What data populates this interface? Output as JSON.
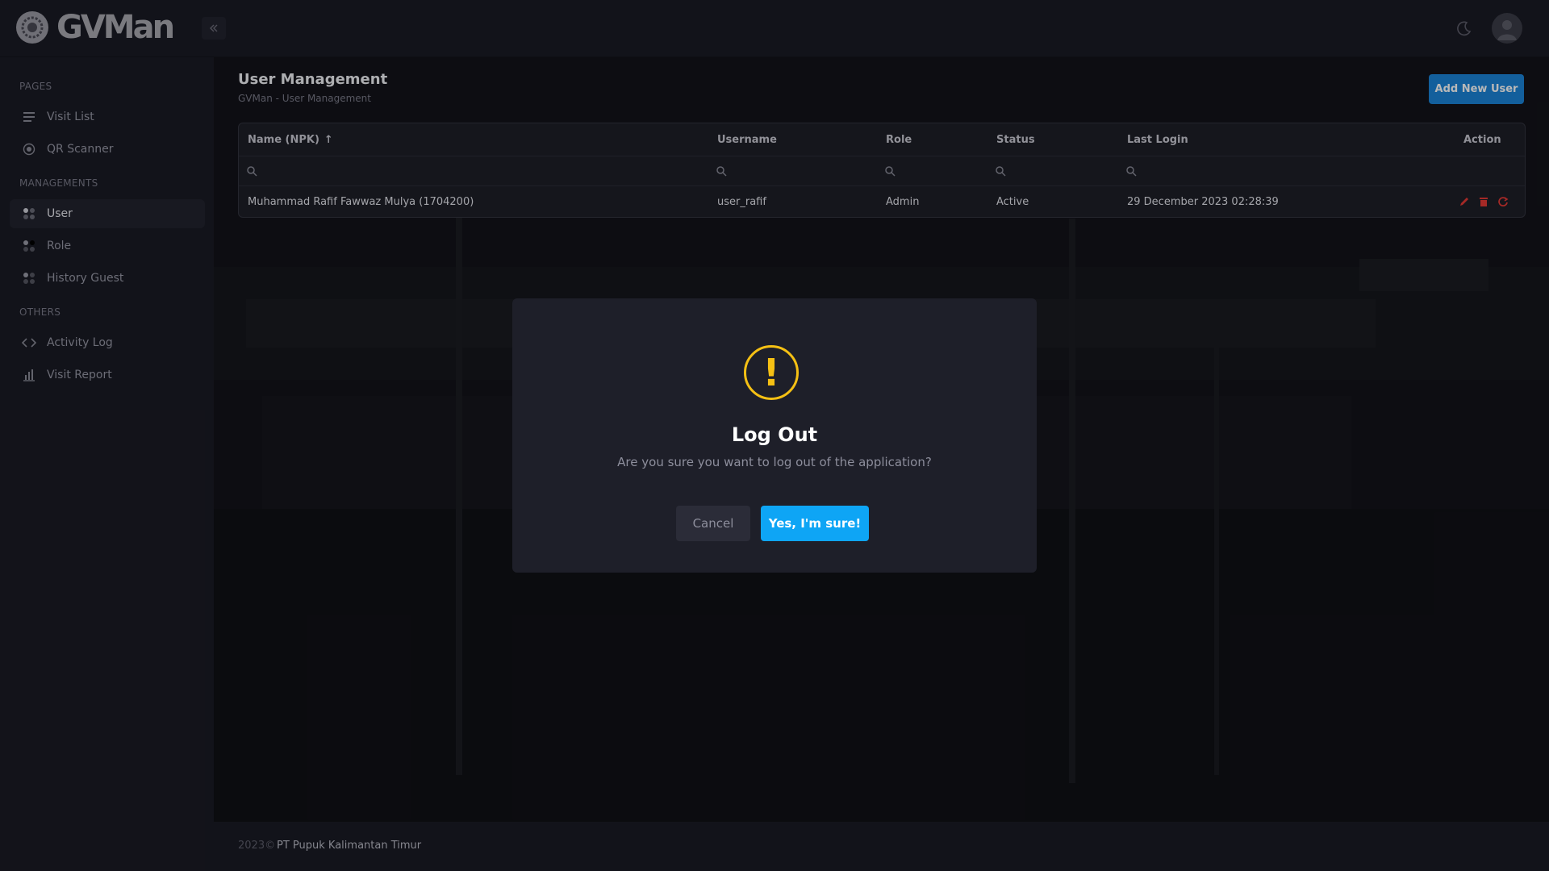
{
  "app": {
    "brand": "GVMan"
  },
  "sidebar": {
    "sections": [
      {
        "title": "PAGES",
        "items": [
          {
            "label": "Visit List",
            "icon": "list-icon"
          },
          {
            "label": "QR Scanner",
            "icon": "target-icon"
          }
        ]
      },
      {
        "title": "MANAGEMENTS",
        "items": [
          {
            "label": "User",
            "icon": "grid-dots-icon",
            "active": true
          },
          {
            "label": "Role",
            "icon": "grid-dots-icon"
          },
          {
            "label": "History Guest",
            "icon": "grid-dots-icon"
          }
        ]
      },
      {
        "title": "OTHERS",
        "items": [
          {
            "label": "Activity Log",
            "icon": "code-icon"
          },
          {
            "label": "Visit Report",
            "icon": "bar-chart-icon"
          }
        ]
      }
    ]
  },
  "page": {
    "title": "User Management",
    "breadcrumb": "GVMan - User Management",
    "add_button": "Add New User"
  },
  "table": {
    "columns": [
      "Name (NPK)",
      "Username",
      "Role",
      "Status",
      "Last Login",
      "Action"
    ],
    "sort_indicator": "↑",
    "rows": [
      {
        "name": "Muhammad Rafif Fawwaz Mulya (1704200)",
        "username": "user_rafif",
        "role": "Admin",
        "status": "Active",
        "last_login": "29 December 2023 02:28:39"
      }
    ]
  },
  "footer": {
    "year": "2023©",
    "company": "PT Pupuk Kalimantan Timur"
  },
  "modal": {
    "icon": "!",
    "title": "Log Out",
    "message": "Are you sure you want to log out of the application?",
    "cancel_label": "Cancel",
    "confirm_label": "Yes, I'm sure!"
  },
  "colors": {
    "accent_blue": "#1b84d8",
    "confirm_blue": "#0ea5f5",
    "warning": "#f5c014",
    "action_red": "#e53935"
  }
}
